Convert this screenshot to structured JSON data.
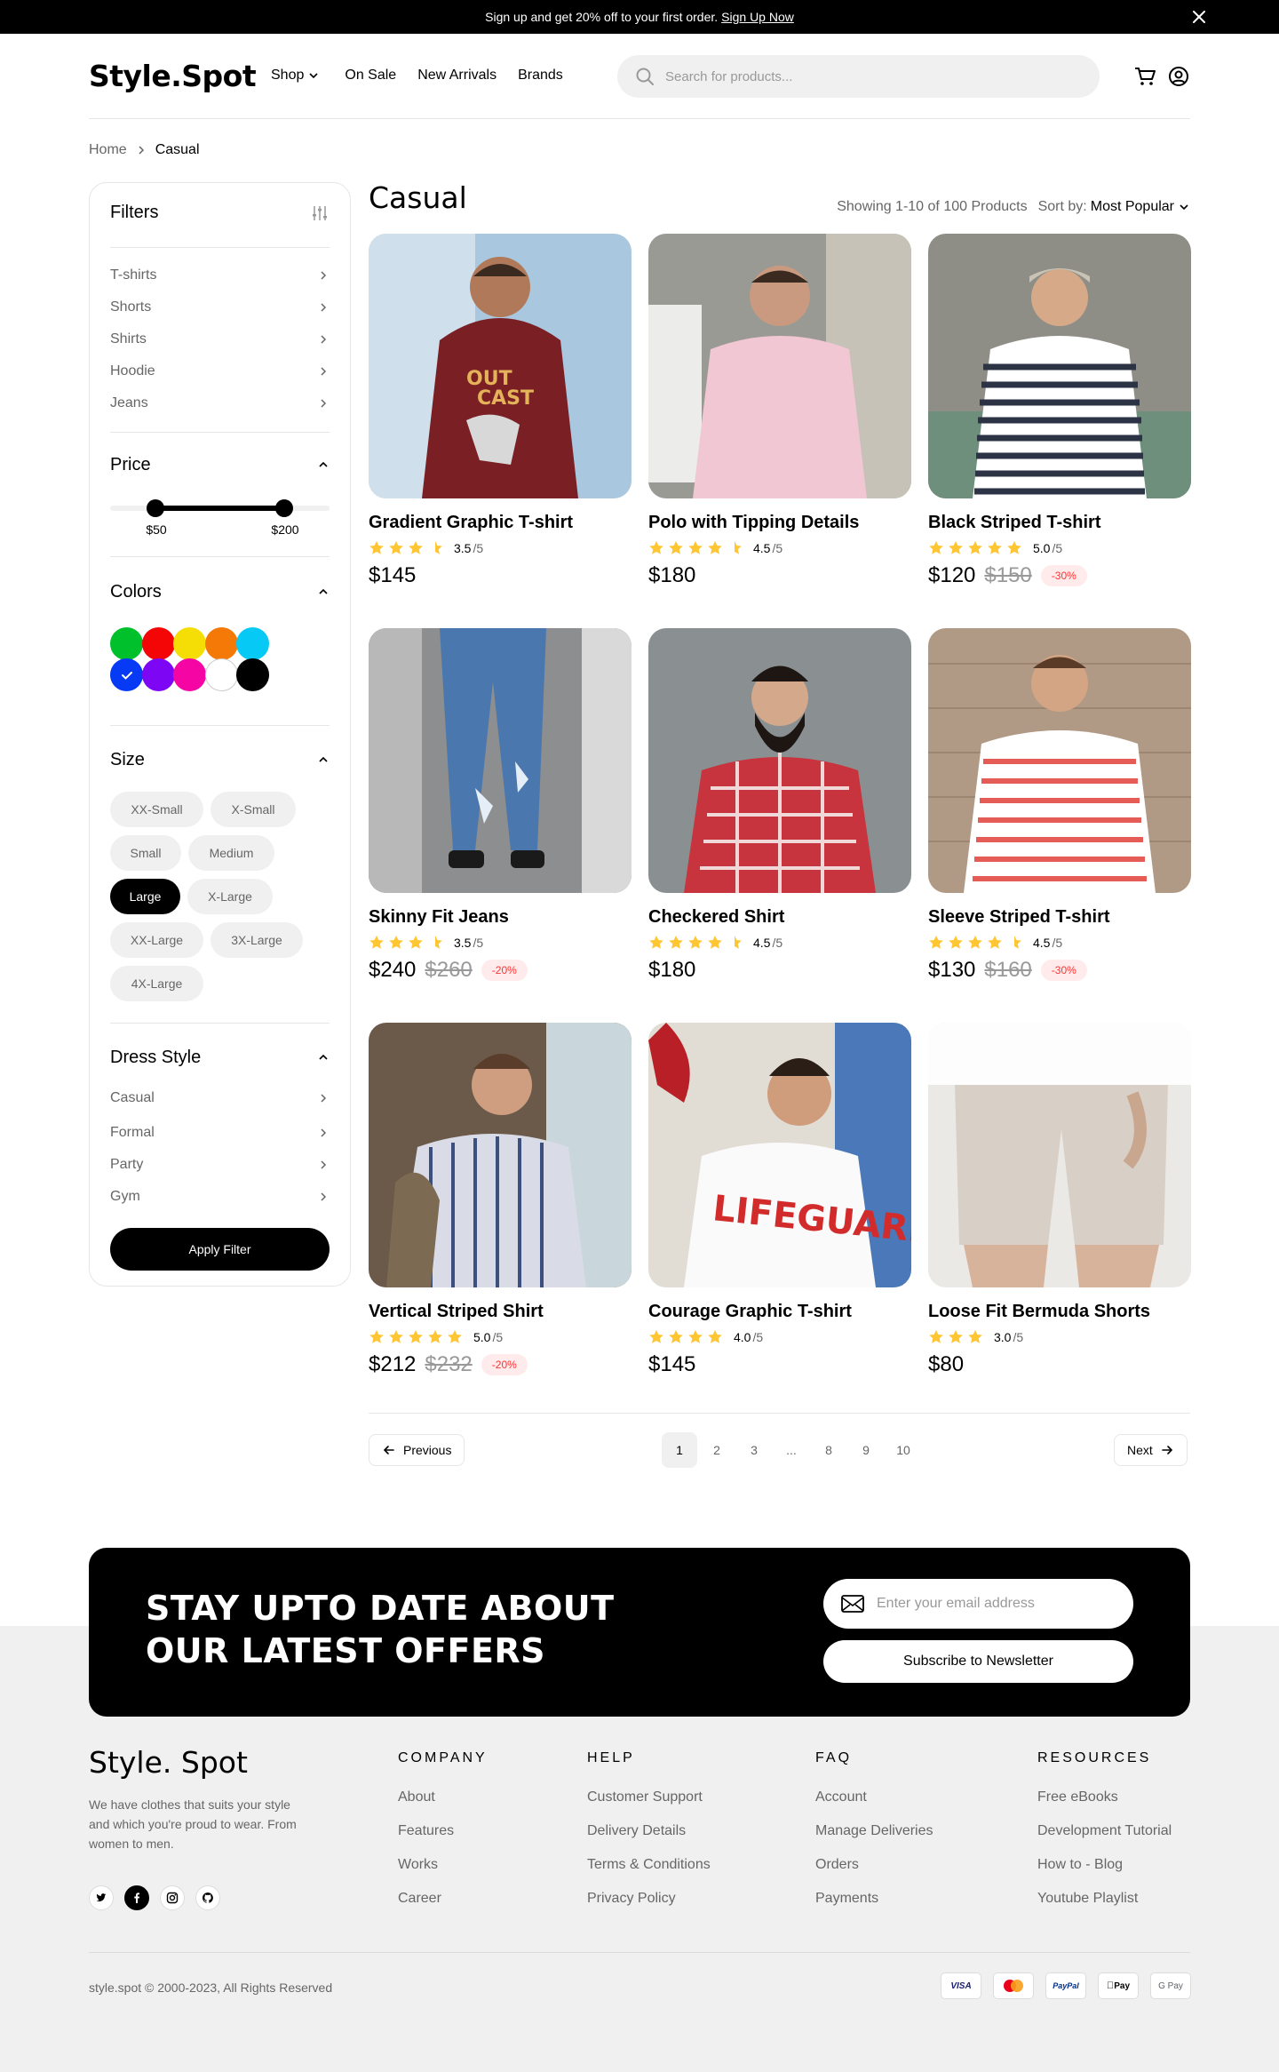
{
  "announcement": {
    "text": "Sign up and get 20% off to your first order.",
    "link": "Sign Up Now"
  },
  "header": {
    "logo": "Style.Spot",
    "nav": [
      "Shop",
      "On Sale",
      "New Arrivals",
      "Brands"
    ],
    "search_placeholder": "Search for products..."
  },
  "breadcrumb": {
    "home": "Home",
    "current": "Casual"
  },
  "filters": {
    "title": "Filters",
    "categories": [
      "T-shirts",
      "Shorts",
      "Shirts",
      "Hoodie",
      "Jeans"
    ],
    "price": {
      "title": "Price",
      "min_label": "$50",
      "max_label": "$200"
    },
    "colors": {
      "title": "Colors",
      "swatches": [
        "#00c12b",
        "#f50606",
        "#f5dd06",
        "#f57906",
        "#06caf5",
        "#063af5",
        "#7d06f5",
        "#f506a4",
        "#ffffff",
        "#000000"
      ],
      "selected": 5
    },
    "size": {
      "title": "Size",
      "options": [
        "XX-Small",
        "X-Small",
        "Small",
        "Medium",
        "Large",
        "X-Large",
        "XX-Large",
        "3X-Large",
        "4X-Large"
      ],
      "selected": "Large"
    },
    "dress_style": {
      "title": "Dress Style",
      "options": [
        "Casual",
        "Formal",
        "Party",
        "Gym"
      ]
    },
    "apply": "Apply Filter"
  },
  "listing": {
    "title": "Casual",
    "showing": "Showing 1-10 of 100 Products",
    "sort_label": "Sort by:",
    "sort_value": "Most Popular"
  },
  "products": [
    {
      "name": "Gradient Graphic T-shirt",
      "rating": "3.5",
      "stars": 3.5,
      "price": "$145",
      "old_price": "",
      "discount": ""
    },
    {
      "name": "Polo with Tipping Details",
      "rating": "4.5",
      "stars": 4.5,
      "price": "$180",
      "old_price": "",
      "discount": ""
    },
    {
      "name": "Black Striped T-shirt",
      "rating": "5.0",
      "stars": 5,
      "price": "$120",
      "old_price": "$150",
      "discount": "-30%"
    },
    {
      "name": "Skinny Fit Jeans",
      "rating": "3.5",
      "stars": 3.5,
      "price": "$240",
      "old_price": "$260",
      "discount": "-20%"
    },
    {
      "name": "Checkered Shirt",
      "rating": "4.5",
      "stars": 4.5,
      "price": "$180",
      "old_price": "",
      "discount": ""
    },
    {
      "name": "Sleeve Striped T-shirt",
      "rating": "4.5",
      "stars": 4.5,
      "price": "$130",
      "old_price": "$160",
      "discount": "-30%"
    },
    {
      "name": "Vertical Striped Shirt",
      "rating": "5.0",
      "stars": 5,
      "price": "$212",
      "old_price": "$232",
      "discount": "-20%"
    },
    {
      "name": "Courage Graphic T-shirt",
      "rating": "4.0",
      "stars": 4,
      "price": "$145",
      "old_price": "",
      "discount": ""
    },
    {
      "name": "Loose Fit Bermuda Shorts",
      "rating": "3.0",
      "stars": 3,
      "price": "$80",
      "old_price": "",
      "discount": ""
    }
  ],
  "rating_suffix": "/5",
  "pagination": {
    "previous": "Previous",
    "next": "Next",
    "pages": [
      "1",
      "2",
      "3",
      "...",
      "8",
      "9",
      "10"
    ],
    "active": "1"
  },
  "newsletter": {
    "heading": "STAY UPTO DATE ABOUT OUR LATEST OFFERS",
    "email_placeholder": "Enter your email address",
    "button": "Subscribe to Newsletter"
  },
  "footer": {
    "logo": "Style. Spot",
    "description": "We have clothes that suits your style and which you're proud to wear. From women to men.",
    "columns": [
      {
        "title": "COMPANY",
        "links": [
          "About",
          "Features",
          "Works",
          "Career"
        ]
      },
      {
        "title": "HELP",
        "links": [
          "Customer Support",
          "Delivery Details",
          "Terms & Conditions",
          "Privacy Policy"
        ]
      },
      {
        "title": "FAQ",
        "links": [
          "Account",
          "Manage Deliveries",
          "Orders",
          "Payments"
        ]
      },
      {
        "title": "RESOURCES",
        "links": [
          "Free eBooks",
          "Development Tutorial",
          "How to - Blog",
          "Youtube Playlist"
        ]
      }
    ],
    "copyright": "style.spot © 2000-2023, All Rights Reserved",
    "payments": [
      "VISA",
      "Mastercard",
      "PayPal",
      "Pay",
      "G Pay"
    ]
  }
}
